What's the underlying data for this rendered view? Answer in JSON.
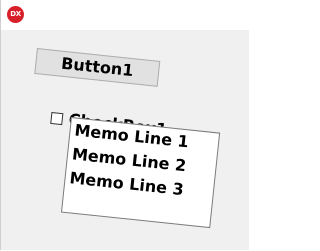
{
  "window": {
    "icon_text": "DX"
  },
  "button1": {
    "label": "Button1"
  },
  "checkbox1": {
    "label": "CheckBox1",
    "checked": false
  },
  "memo1": {
    "lines": [
      "Memo Line 1",
      "Memo Line 2",
      "Memo Line 3"
    ]
  },
  "colors": {
    "icon_bg": "#d8202b",
    "client_bg": "#f0f0f0",
    "button_bg": "#e1e1e1"
  }
}
